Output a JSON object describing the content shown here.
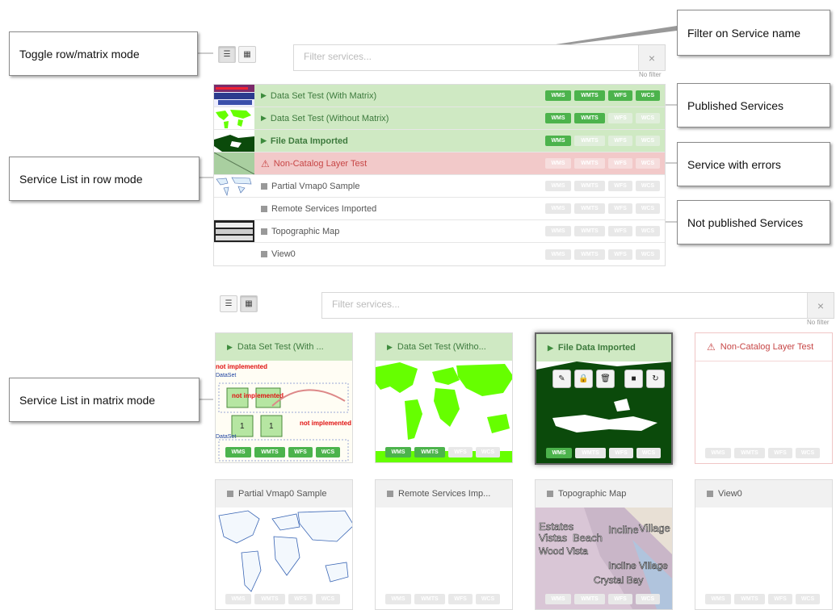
{
  "callouts": {
    "toggle": "Toggle row/matrix mode",
    "filter": "Filter on Service name",
    "published": "Published  Services",
    "errors": "Service with errors",
    "row_mode": "Service List in row mode",
    "not_published": "Not published  Services",
    "matrix_mode": "Service List in matrix mode"
  },
  "filter": {
    "placeholder": "Filter services...",
    "clear_label": "×",
    "status": "No filter"
  },
  "badge_labels": [
    "WMS",
    "WMTS",
    "WFS",
    "WCS"
  ],
  "rows": [
    {
      "name": "Data Set Test (With Matrix)",
      "state": "published",
      "services": [
        true,
        true,
        true,
        true
      ]
    },
    {
      "name": "Data Set Test (Without Matrix)",
      "state": "published",
      "services": [
        true,
        true,
        false,
        false
      ]
    },
    {
      "name": "File Data Imported",
      "state": "published",
      "services": [
        true,
        false,
        false,
        false
      ]
    },
    {
      "name": "Non-Catalog Layer Test",
      "state": "error",
      "services": [
        false,
        false,
        false,
        false
      ]
    },
    {
      "name": "Partial Vmap0 Sample",
      "state": "unpublished",
      "services": [
        false,
        false,
        false,
        false
      ]
    },
    {
      "name": "Remote Services Imported",
      "state": "unpublished",
      "services": [
        false,
        false,
        false,
        false
      ]
    },
    {
      "name": "Topographic Map",
      "state": "unpublished",
      "services": [
        false,
        false,
        false,
        false
      ]
    },
    {
      "name": "View0",
      "state": "unpublished",
      "services": [
        false,
        false,
        false,
        false
      ]
    }
  ],
  "cards": [
    {
      "title": "Data Set Test (With ...",
      "state": "published",
      "services": [
        true,
        true,
        true,
        true
      ]
    },
    {
      "title": "Data Set Test (Witho...",
      "state": "published",
      "services": [
        true,
        true,
        false,
        false
      ]
    },
    {
      "title": "File Data Imported",
      "state": "published",
      "selected": true,
      "services": [
        true,
        false,
        false,
        false
      ]
    },
    {
      "title": "Non-Catalog Layer Test",
      "state": "error",
      "services": [
        false,
        false,
        false,
        false
      ]
    },
    {
      "title": "Partial Vmap0 Sample",
      "state": "unpublished",
      "services": [
        false,
        false,
        false,
        false
      ]
    },
    {
      "title": "Remote Services Imp...",
      "state": "unpublished",
      "services": [
        false,
        false,
        false,
        false
      ]
    },
    {
      "title": "Topographic Map",
      "state": "unpublished",
      "services": [
        false,
        false,
        false,
        false
      ]
    },
    {
      "title": "View0",
      "state": "unpublished",
      "services": [
        false,
        false,
        false,
        false
      ]
    }
  ],
  "thumb_text": {
    "not_implemented": "not implemented",
    "dataset_labels": [
      "DataSet",
      "1"
    ],
    "topo_labels": [
      "Estates",
      "Vistas",
      "Beach",
      "Incline",
      "Village",
      "Wood Vista",
      "Crystal Bay"
    ]
  },
  "colors": {
    "published_bg": "#cfe9c3",
    "error_bg": "#f2c9c9",
    "badge_on": "#4cb34c",
    "green_map": "#66ff00",
    "dark_green_map": "#0b4a0b"
  }
}
